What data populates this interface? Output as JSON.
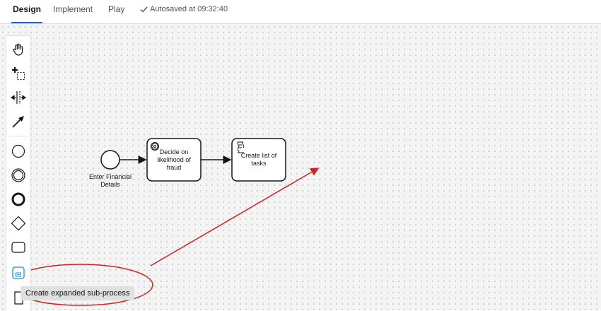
{
  "tabs": [
    {
      "label": "Design",
      "active": true
    },
    {
      "label": "Implement",
      "active": false
    },
    {
      "label": "Play",
      "active": false
    }
  ],
  "autosave": {
    "text": "Autosaved at 09:32:40",
    "icon": "checkmark-icon"
  },
  "palette": {
    "tools": [
      {
        "name": "hand-tool",
        "icon": "hand-icon"
      },
      {
        "name": "lasso-tool",
        "icon": "lasso-icon"
      },
      {
        "name": "space-tool",
        "icon": "space-icon"
      },
      {
        "name": "connect-tool",
        "icon": "arrow-icon"
      },
      {
        "name": "start-event",
        "icon": "circle-thin-icon"
      },
      {
        "name": "intermediate-event",
        "icon": "double-circle-icon"
      },
      {
        "name": "end-event",
        "icon": "circle-thick-icon"
      },
      {
        "name": "gateway",
        "icon": "diamond-icon"
      },
      {
        "name": "task",
        "icon": "rounded-rect-icon"
      },
      {
        "name": "expanded-subprocess",
        "icon": "subprocess-icon"
      }
    ],
    "tooltip": "Create expanded sub-process"
  },
  "diagram": {
    "start_event_label": "Enter Financial Details",
    "task1": {
      "label": "Decide on likelihood of fraud",
      "icon": "ai-icon"
    },
    "task2": {
      "label": "Create list of tasks",
      "icon": "script-icon"
    }
  },
  "colors": {
    "accent": "#0f62fe",
    "annotation": "#d91e1e",
    "tool_active": "#1192e8"
  }
}
